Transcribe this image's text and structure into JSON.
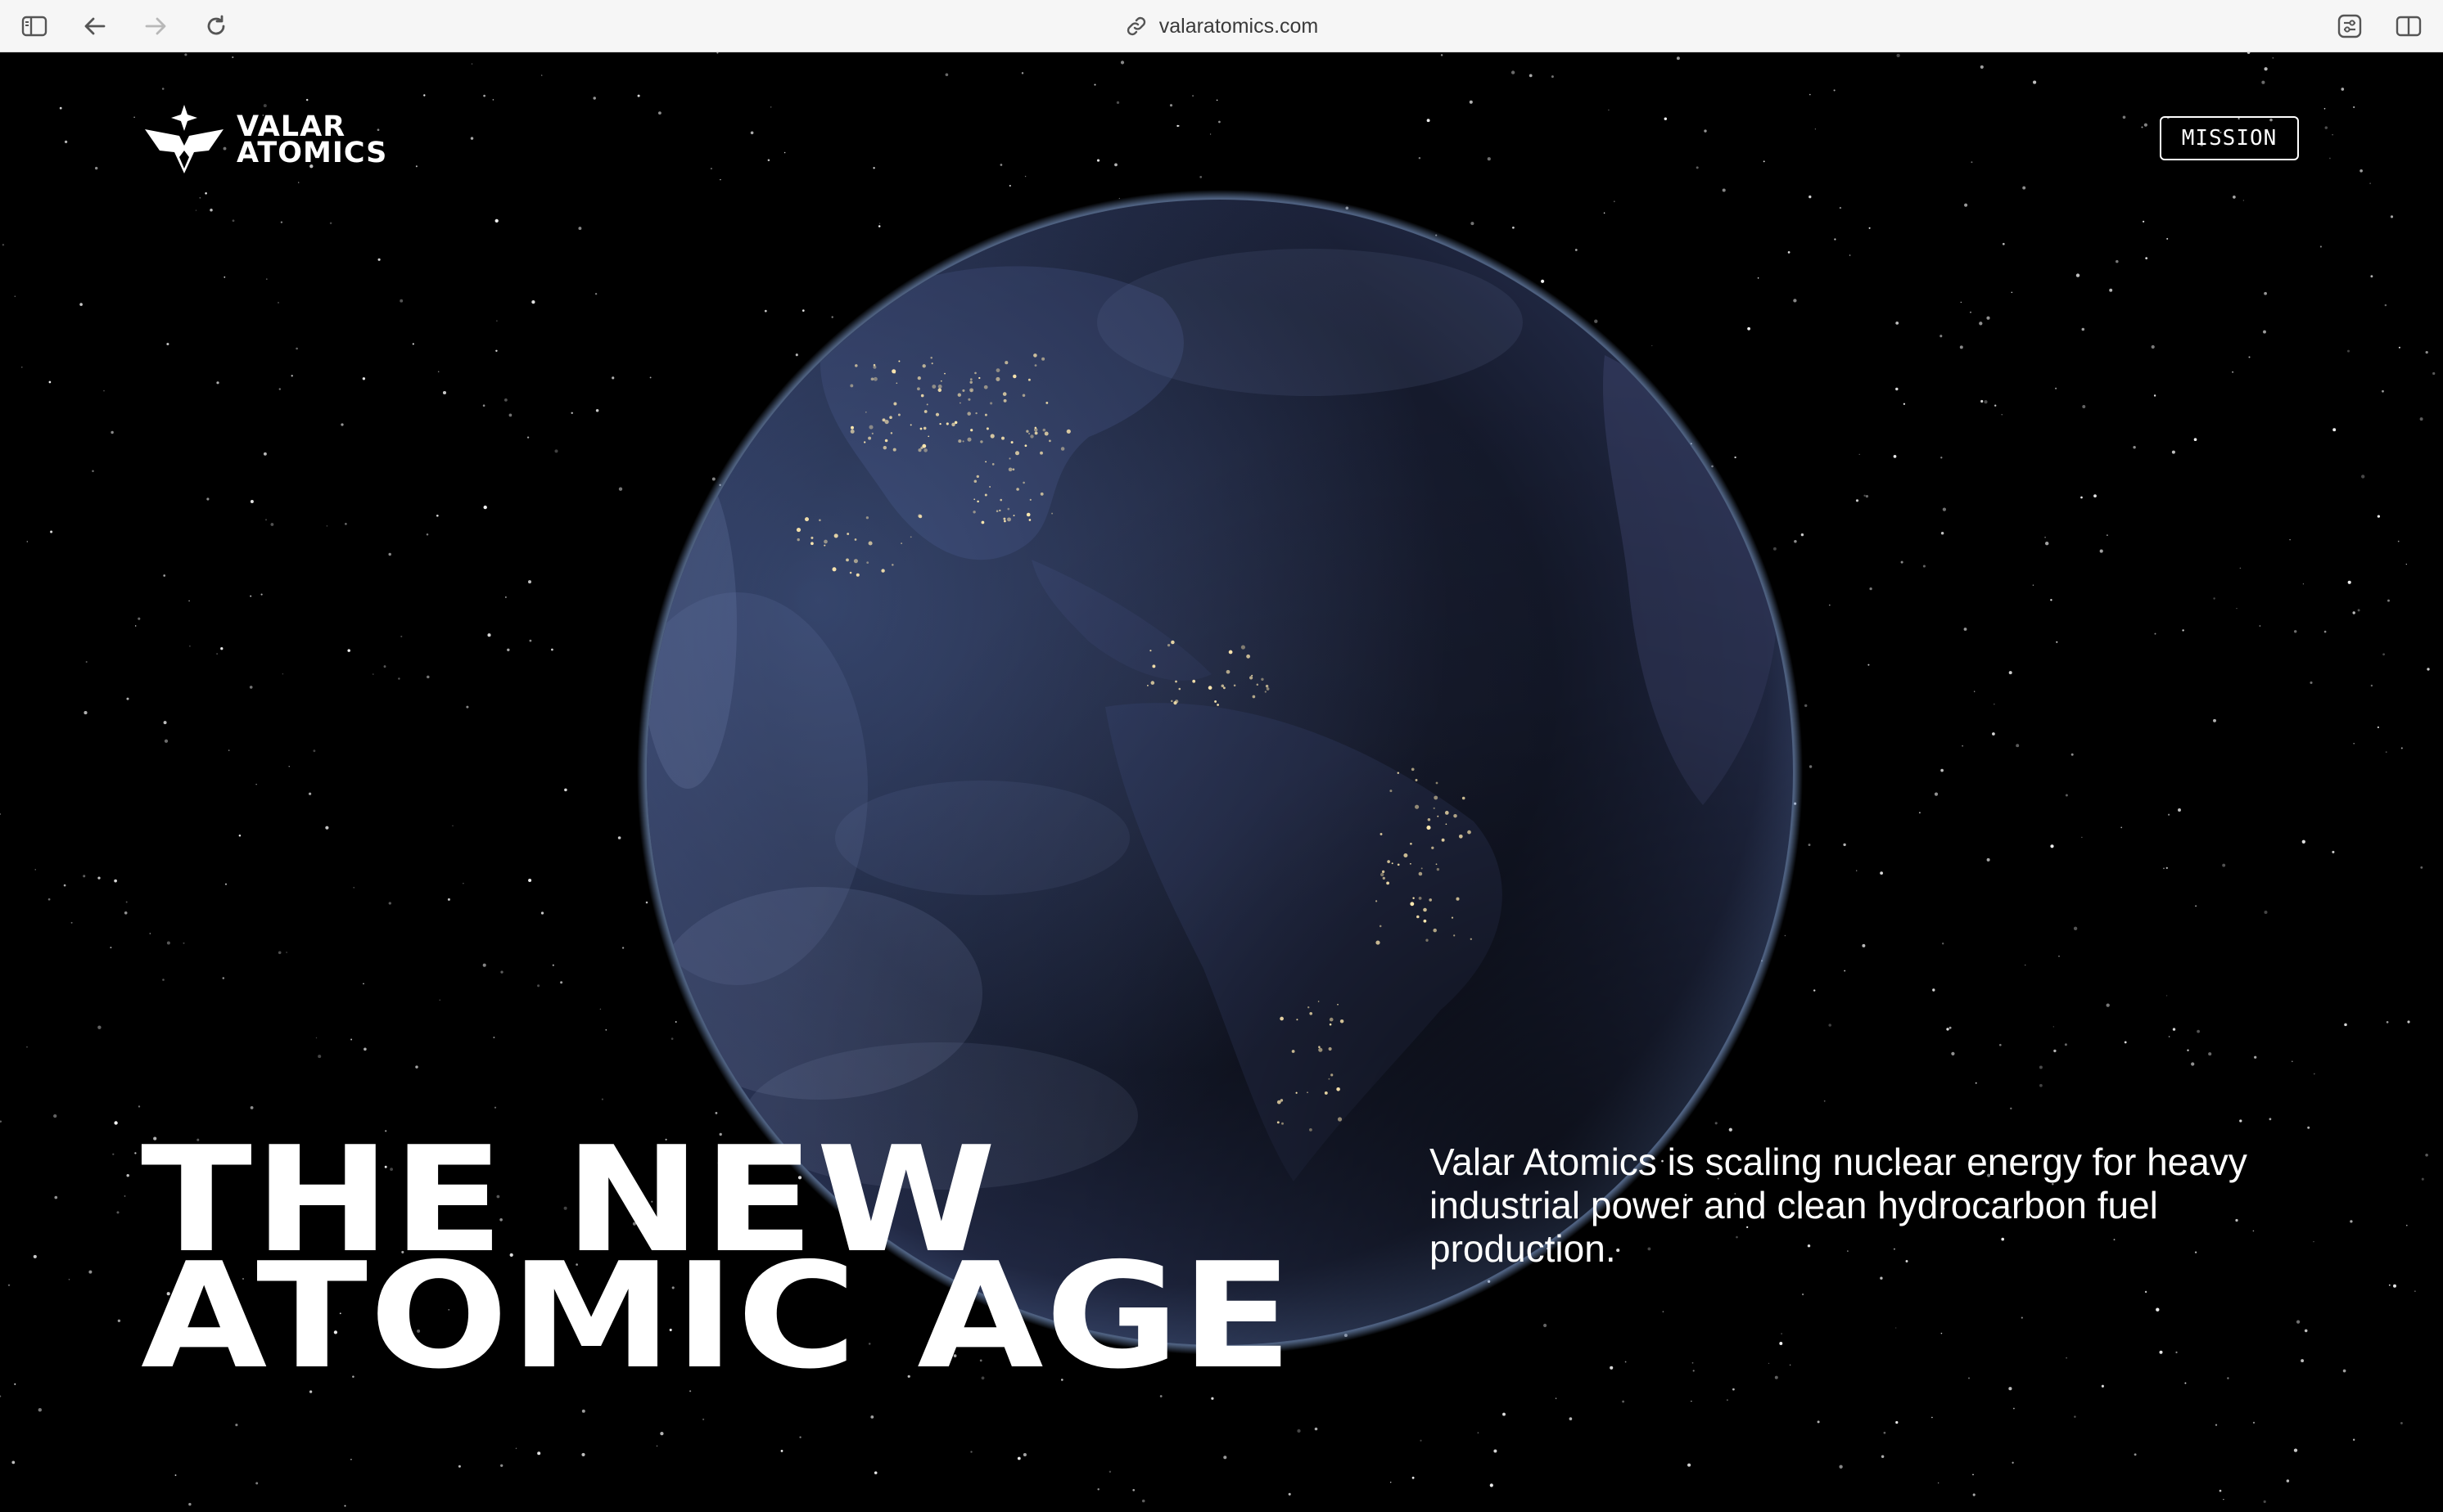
{
  "browser": {
    "url": "valaratomics.com",
    "icons": {
      "sidebar": "sidebar-icon",
      "back": "arrow-left-icon",
      "forward": "arrow-right-icon",
      "reload": "reload-icon",
      "link": "link-icon",
      "extension": "extension-icon",
      "split_view": "split-view-icon"
    }
  },
  "header": {
    "logo_line1": "VALAR",
    "logo_line2": "ATOMICS",
    "mission_label": "MISSION"
  },
  "hero": {
    "headline_line1": "THE NEW",
    "headline_line2": "ATOMIC AGE",
    "tagline": "Valar Atomics is scaling nuclear energy for heavy industrial power and clean hydrocarbon fuel production."
  },
  "colors": {
    "background": "#000000",
    "text": "#ffffff",
    "chrome": "#f6f6f6"
  }
}
